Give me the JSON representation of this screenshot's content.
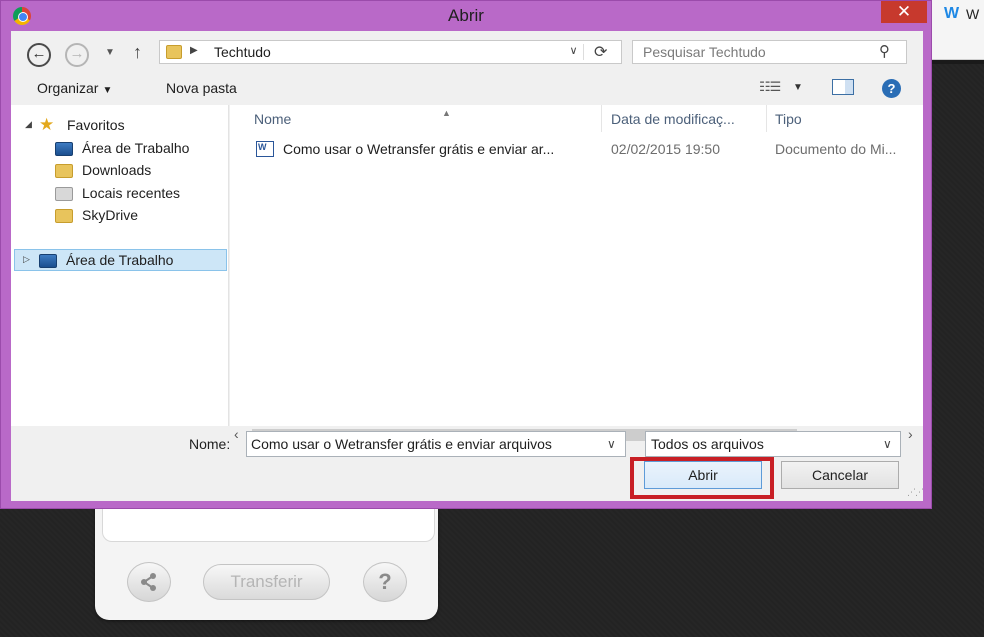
{
  "background_page": {
    "tab_logo": "W",
    "tab_text": "W",
    "transfer_label": "Transferir",
    "help_label": "?"
  },
  "dialog": {
    "title": "Abrir",
    "close_label": "✕",
    "address": {
      "path": "Techtudo"
    },
    "search": {
      "placeholder": "Pesquisar Techtudo"
    },
    "toolbar": {
      "organize_label": "Organizar",
      "new_folder_label": "Nova pasta"
    },
    "nav_pane": {
      "favorites_label": "Favoritos",
      "items": [
        {
          "label": "Área de Trabalho",
          "icon": "desktop-icon"
        },
        {
          "label": "Downloads",
          "icon": "downloads-folder-icon"
        },
        {
          "label": "Locais recentes",
          "icon": "recent-places-icon"
        },
        {
          "label": "SkyDrive",
          "icon": "skydrive-folder-icon"
        }
      ],
      "selected_root": "Área de Trabalho"
    },
    "file_list": {
      "columns": [
        "Nome",
        "Data de modificaç...",
        "Tipo"
      ],
      "rows": [
        {
          "name": "Como usar o Wetransfer grátis e enviar ar...",
          "modified": "02/02/2015 19:50",
          "type": "Documento do Mi..."
        }
      ]
    },
    "bottom": {
      "name_label": "Nome:",
      "name_value": "Como usar o Wetransfer grátis e enviar arquivos",
      "file_type": "Todos os arquivos",
      "open_label": "Abrir",
      "cancel_label": "Cancelar"
    }
  },
  "colors": {
    "dialog_frame": "#b969c8",
    "close_button": "#c7392d",
    "highlight_box": "#c81f25",
    "selection": "#cde6f7"
  }
}
